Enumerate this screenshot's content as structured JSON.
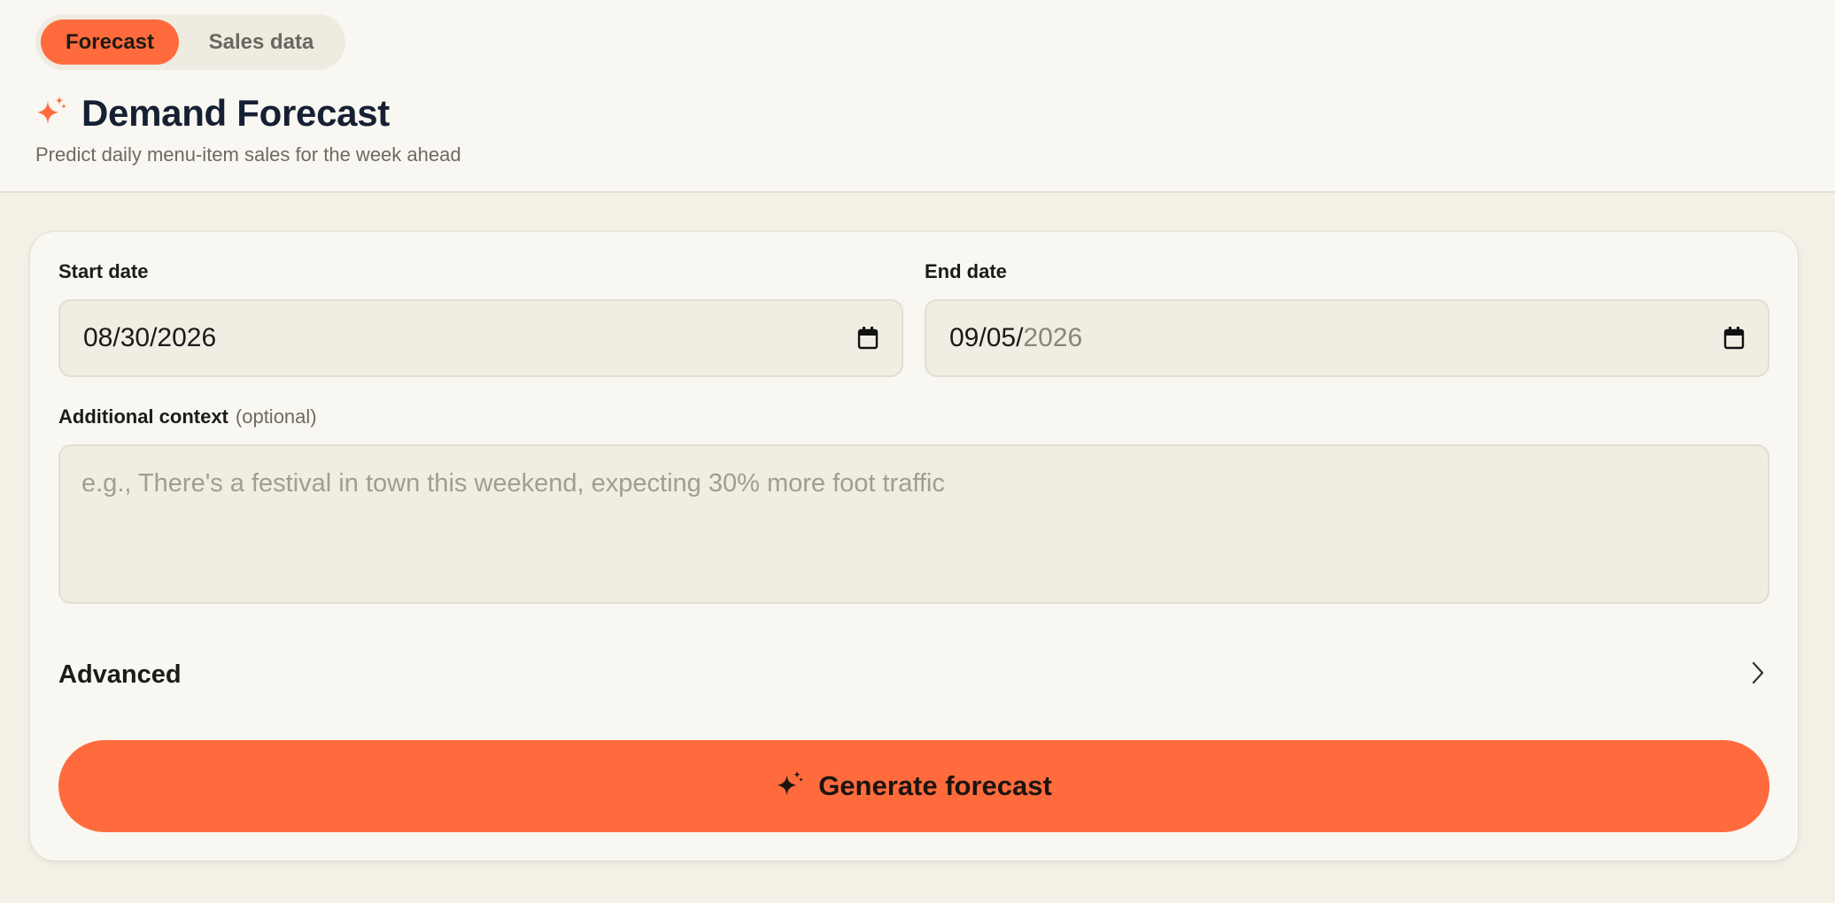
{
  "tabs": {
    "forecast": "Forecast",
    "sales_data": "Sales data"
  },
  "header": {
    "title": "Demand Forecast",
    "subtitle": "Predict daily menu-item sales for the week ahead",
    "icon": "sparkle-icon"
  },
  "form": {
    "start_date_label": "Start date",
    "start_date_value": "08/30/2026",
    "end_date_label": "End date",
    "end_date_value_main": "09/05/",
    "end_date_value_muted": "2026",
    "context_label": "Additional context",
    "context_optional": "(optional)",
    "context_placeholder": "e.g., There's a festival in town this weekend, expecting 30% more foot traffic",
    "advanced_label": "Advanced",
    "generate_label": "Generate forecast"
  },
  "colors": {
    "accent": "#ff6b3d",
    "title": "#162033",
    "background": "#f3f0e6"
  }
}
